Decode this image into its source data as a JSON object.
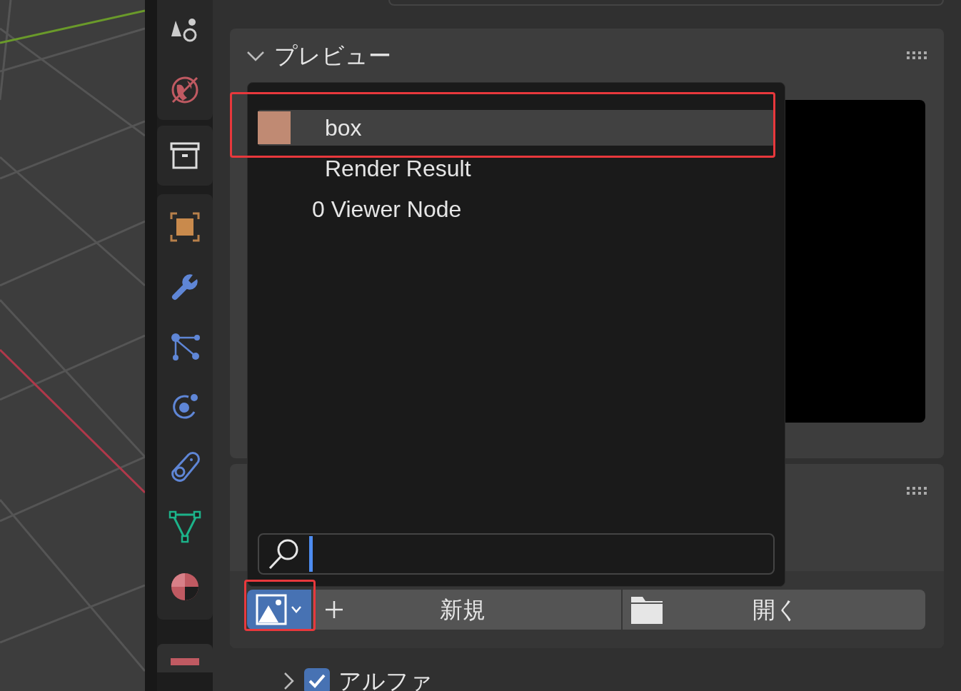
{
  "preview_panel": {
    "title": "プレビュー",
    "expanded": true
  },
  "image_menu": {
    "items": [
      {
        "label": "box",
        "selected": true,
        "kind": "thumbnail"
      },
      {
        "label": "Render Result",
        "selected": false,
        "kind": "plain"
      },
      {
        "label": "0 Viewer Node",
        "selected": false,
        "kind": "plain"
      }
    ],
    "search_focused": true
  },
  "image_buttons": {
    "new": "新規",
    "open": "開く"
  },
  "alpha": {
    "label": "アルファ",
    "checked": true,
    "expanded": false
  }
}
